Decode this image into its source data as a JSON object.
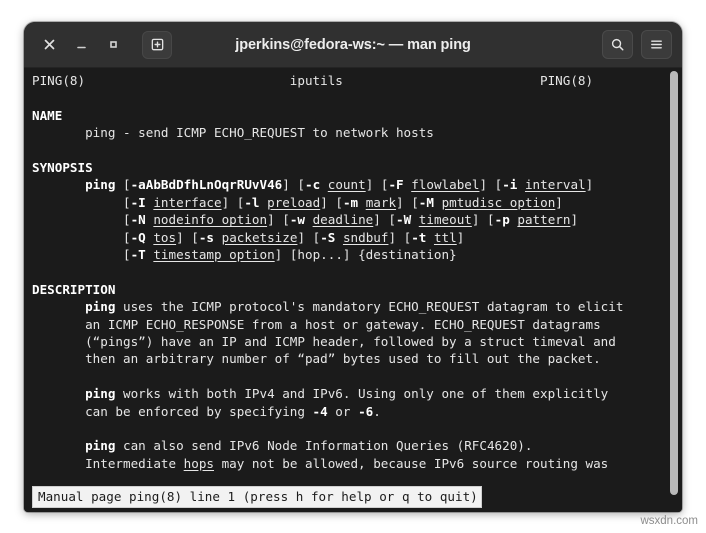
{
  "window": {
    "title": "jperkins@fedora-ws:~ — man ping",
    "titlebar_color": "#303030",
    "terminal_bg": "#1b1b1b",
    "terminal_fg": "#e6e6e6"
  },
  "titlebar": {
    "close_label": "✕",
    "minimize_label": "−",
    "maximize_label": "□",
    "newtab_label": "new-tab",
    "search_label": "search",
    "menu_label": "menu"
  },
  "terminal": {
    "header": {
      "left": "PING(8)",
      "center": "iputils",
      "right": "PING(8)"
    },
    "sections": {
      "name_heading": "NAME",
      "name_body": "ping - send ICMP ECHO_REQUEST to network hosts",
      "synopsis_heading": "SYNOPSIS",
      "description_heading": "DESCRIPTION"
    },
    "synopsis": {
      "command": "ping",
      "line1": "[-aAbBdDfhLnOqrRUvV46] [-c count] [-F flowlabel] [-i interval]",
      "line2": "[-I interface] [-l preload] [-m mark] [-M pmtudisc option]",
      "line3": "[-N nodeinfo option] [-w deadline] [-W timeout] [-p pattern]",
      "line4": "[-Q tos] [-s packetsize] [-S sndbuf] [-t ttl]",
      "line5": "[-T timestamp option] [hop...] {destination}"
    },
    "description": {
      "p1_line1_rest": " uses the ICMP protocol's mandatory ECHO_REQUEST datagram to elicit",
      "p1_line2": "an ICMP ECHO_RESPONSE from a host or gateway. ECHO_REQUEST datagrams",
      "p1_line3": "(“pings”) have an IP and ICMP header, followed by a struct timeval and",
      "p1_line4": "then an arbitrary number of “pad” bytes used to fill out the packet.",
      "p2_line1_rest": " works with both IPv4 and IPv6. Using only one of them explicitly",
      "p2_line2_a": "can be enforced by specifying ",
      "p2_flag4": "-4",
      "p2_line2_b": " or ",
      "p2_flag6": "-6",
      "p2_line2_c": ".",
      "p3_line1_rest": " can also send IPv6 Node Information Queries (RFC4620).",
      "p3_line2_a": "Intermediate ",
      "p3_hops": "hops",
      "p3_line2_b": " may not be allowed, because IPv6 source routing was"
    },
    "status_line": "Manual page ping(8) line 1 (press h for help or q to quit)"
  },
  "watermark": "wsxdn.com"
}
